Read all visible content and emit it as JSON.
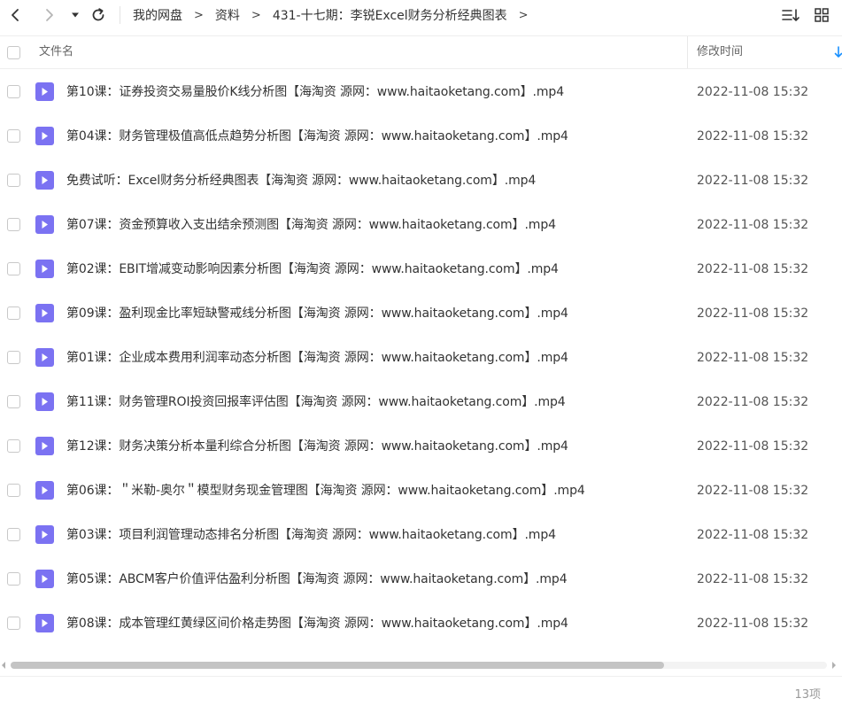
{
  "toolbar": {
    "back_icon": "chevron-left-icon",
    "forward_icon": "chevron-right-icon",
    "history_icon": "caret-down-icon",
    "refresh_icon": "refresh-icon",
    "sort_icon": "sort-list-icon",
    "view_icon": "grid-view-icon"
  },
  "breadcrumb": {
    "items": [
      "我的网盘",
      "资料",
      "431-十七期：李锐Excel财务分析经典图表"
    ],
    "separator": ">"
  },
  "header": {
    "name_label": "文件名",
    "time_label": "修改时间"
  },
  "files": [
    {
      "name": "第10课：证券投资交易量股价K线分析图【海淘资 源网：www.haitaoketang.com】.mp4",
      "time": "2022-11-08 15:32"
    },
    {
      "name": "第04课：财务管理极值高低点趋势分析图【海淘资 源网：www.haitaoketang.com】.mp4",
      "time": "2022-11-08 15:32"
    },
    {
      "name": "免费试听：Excel财务分析经典图表【海淘资 源网：www.haitaoketang.com】.mp4",
      "time": "2022-11-08 15:32"
    },
    {
      "name": "第07课：资金预算收入支出结余预测图【海淘资 源网：www.haitaoketang.com】.mp4",
      "time": "2022-11-08 15:32"
    },
    {
      "name": "第02课：EBIT增减变动影响因素分析图【海淘资 源网：www.haitaoketang.com】.mp4",
      "time": "2022-11-08 15:32"
    },
    {
      "name": "第09课：盈利现金比率短缺警戒线分析图【海淘资 源网：www.haitaoketang.com】.mp4",
      "time": "2022-11-08 15:32"
    },
    {
      "name": "第01课：企业成本费用利润率动态分析图【海淘资 源网：www.haitaoketang.com】.mp4",
      "time": "2022-11-08 15:32"
    },
    {
      "name": "第11课：财务管理ROI投资回报率评估图【海淘资 源网：www.haitaoketang.com】.mp4",
      "time": "2022-11-08 15:32"
    },
    {
      "name": "第12课：财务决策分析本量利综合分析图【海淘资 源网：www.haitaoketang.com】.mp4",
      "time": "2022-11-08 15:32"
    },
    {
      "name": "第06课：＂米勒-奥尔＂模型财务现金管理图【海淘资 源网：www.haitaoketang.com】.mp4",
      "time": "2022-11-08 15:32"
    },
    {
      "name": "第03课：项目利润管理动态排名分析图【海淘资 源网：www.haitaoketang.com】.mp4",
      "time": "2022-11-08 15:32"
    },
    {
      "name": "第05课：ABCM客户价值评估盈利分析图【海淘资 源网：www.haitaoketang.com】.mp4",
      "time": "2022-11-08 15:32"
    },
    {
      "name": "第08课：成本管理红黄绿区间价格走势图【海淘资 源网：www.haitaoketang.com】.mp4",
      "time": "2022-11-08 15:32"
    }
  ],
  "file_icon": "video-file-icon",
  "footer": {
    "count_label": "13项"
  },
  "colors": {
    "video_icon": "#7b72f2",
    "accent": "#1890ff",
    "text": "#333333",
    "muted": "#999999",
    "scroll_thumb": "#c4c4c4"
  },
  "scroll": {
    "horizontal_position_fraction": 0.0,
    "visible_fraction": 0.8
  }
}
